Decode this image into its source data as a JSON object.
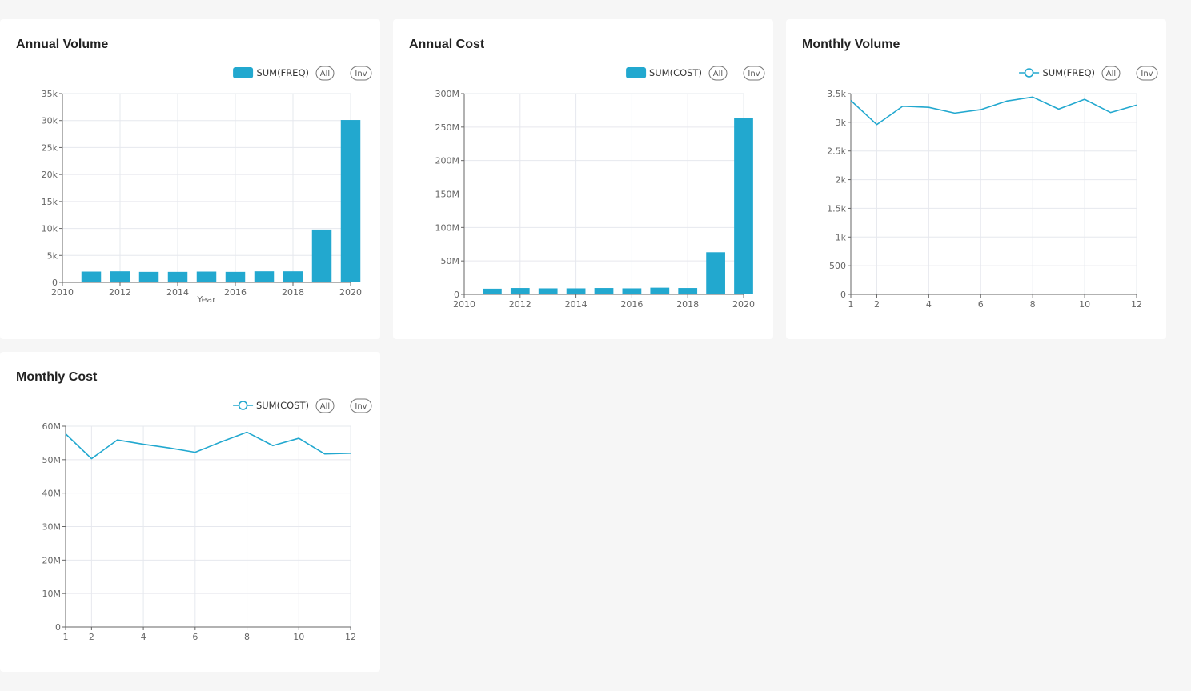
{
  "colors": {
    "series": "#22a8cf",
    "grid": "#e6e8ee",
    "axis": "#666666",
    "background": "#f6f6f6",
    "card": "#ffffff"
  },
  "icons": {
    "bar_legend": "rounded-rect-swatch",
    "line_legend": "line-with-hollow-circle"
  },
  "cards": [
    {
      "title": "Annual Volume",
      "legend": {
        "label": "SUM(FREQ)",
        "all_label": "All",
        "inv_label": "Inv"
      },
      "chart_data": {
        "type": "bar",
        "title": "Annual Volume",
        "x": [
          2011,
          2012,
          2013,
          2014,
          2015,
          2016,
          2017,
          2018,
          2019,
          2020
        ],
        "series": [
          {
            "name": "SUM(FREQ)",
            "values": [
              2000,
              2050,
              1950,
              1950,
              2000,
              1950,
              2050,
              2050,
              9800,
              30100
            ]
          }
        ],
        "xlim": [
          2010,
          2020
        ],
        "xticks": [
          "2010",
          "2012",
          "2014",
          "2016",
          "2018",
          "2020"
        ],
        "xlabel": "Year",
        "ylabel": "",
        "ylim": [
          0,
          35000
        ],
        "yticks": [
          "0",
          "5k",
          "10k",
          "15k",
          "20k",
          "25k",
          "30k",
          "35k"
        ],
        "grid": true,
        "legend_position": "top-right"
      }
    },
    {
      "title": "Annual Cost",
      "legend": {
        "label": "SUM(COST)",
        "all_label": "All",
        "inv_label": "Inv"
      },
      "chart_data": {
        "type": "bar",
        "title": "Annual Cost",
        "x": [
          2011,
          2012,
          2013,
          2014,
          2015,
          2016,
          2017,
          2018,
          2019,
          2020
        ],
        "series": [
          {
            "name": "SUM(COST)",
            "values": [
              8500000,
              9500000,
              9000000,
              9000000,
              9500000,
              9000000,
              10000000,
              9500000,
              63000000,
              264000000
            ]
          }
        ],
        "xlim": [
          2010,
          2020
        ],
        "xticks": [
          "2010",
          "2012",
          "2014",
          "2016",
          "2018",
          "2020"
        ],
        "xlabel": "",
        "ylabel": "",
        "ylim": [
          0,
          300000000
        ],
        "yticks": [
          "0",
          "50M",
          "100M",
          "150M",
          "200M",
          "250M",
          "300M"
        ],
        "grid": true,
        "legend_position": "top-right"
      }
    },
    {
      "title": "Monthly Volume",
      "legend": {
        "label": "SUM(FREQ)",
        "all_label": "All",
        "inv_label": "Inv"
      },
      "chart_data": {
        "type": "line",
        "title": "Monthly Volume",
        "x": [
          1,
          2,
          3,
          4,
          5,
          6,
          7,
          8,
          9,
          10,
          11,
          12
        ],
        "series": [
          {
            "name": "SUM(FREQ)",
            "values": [
              3380,
              2960,
              3280,
              3260,
              3160,
              3220,
              3370,
              3440,
              3230,
              3400,
              3170,
              3300
            ]
          }
        ],
        "xlim": [
          1,
          12
        ],
        "xticks": [
          "1",
          "2",
          "4",
          "6",
          "8",
          "10",
          "12"
        ],
        "xlabel": "",
        "ylabel": "",
        "ylim": [
          0,
          3500
        ],
        "yticks": [
          "0",
          "500",
          "1k",
          "1.5k",
          "2k",
          "2.5k",
          "3k",
          "3.5k"
        ],
        "grid": true,
        "legend_position": "top-right"
      }
    },
    {
      "title": "Monthly Cost",
      "legend": {
        "label": "SUM(COST)",
        "all_label": "All",
        "inv_label": "Inv"
      },
      "chart_data": {
        "type": "line",
        "title": "Monthly Cost",
        "x": [
          1,
          2,
          3,
          4,
          5,
          6,
          7,
          8,
          9,
          10,
          11,
          12
        ],
        "series": [
          {
            "name": "SUM(COST)",
            "values": [
              57700000,
              50300000,
              55900000,
              54600000,
              53500000,
              52200000,
              55300000,
              58200000,
              54200000,
              56400000,
              51700000,
              51900000
            ]
          }
        ],
        "xlim": [
          1,
          12
        ],
        "xticks": [
          "1",
          "2",
          "4",
          "6",
          "8",
          "10",
          "12"
        ],
        "xlabel": "",
        "ylabel": "",
        "ylim": [
          0,
          60000000
        ],
        "yticks": [
          "0",
          "10M",
          "20M",
          "30M",
          "40M",
          "50M",
          "60M"
        ],
        "grid": true,
        "legend_position": "top-right"
      }
    }
  ]
}
